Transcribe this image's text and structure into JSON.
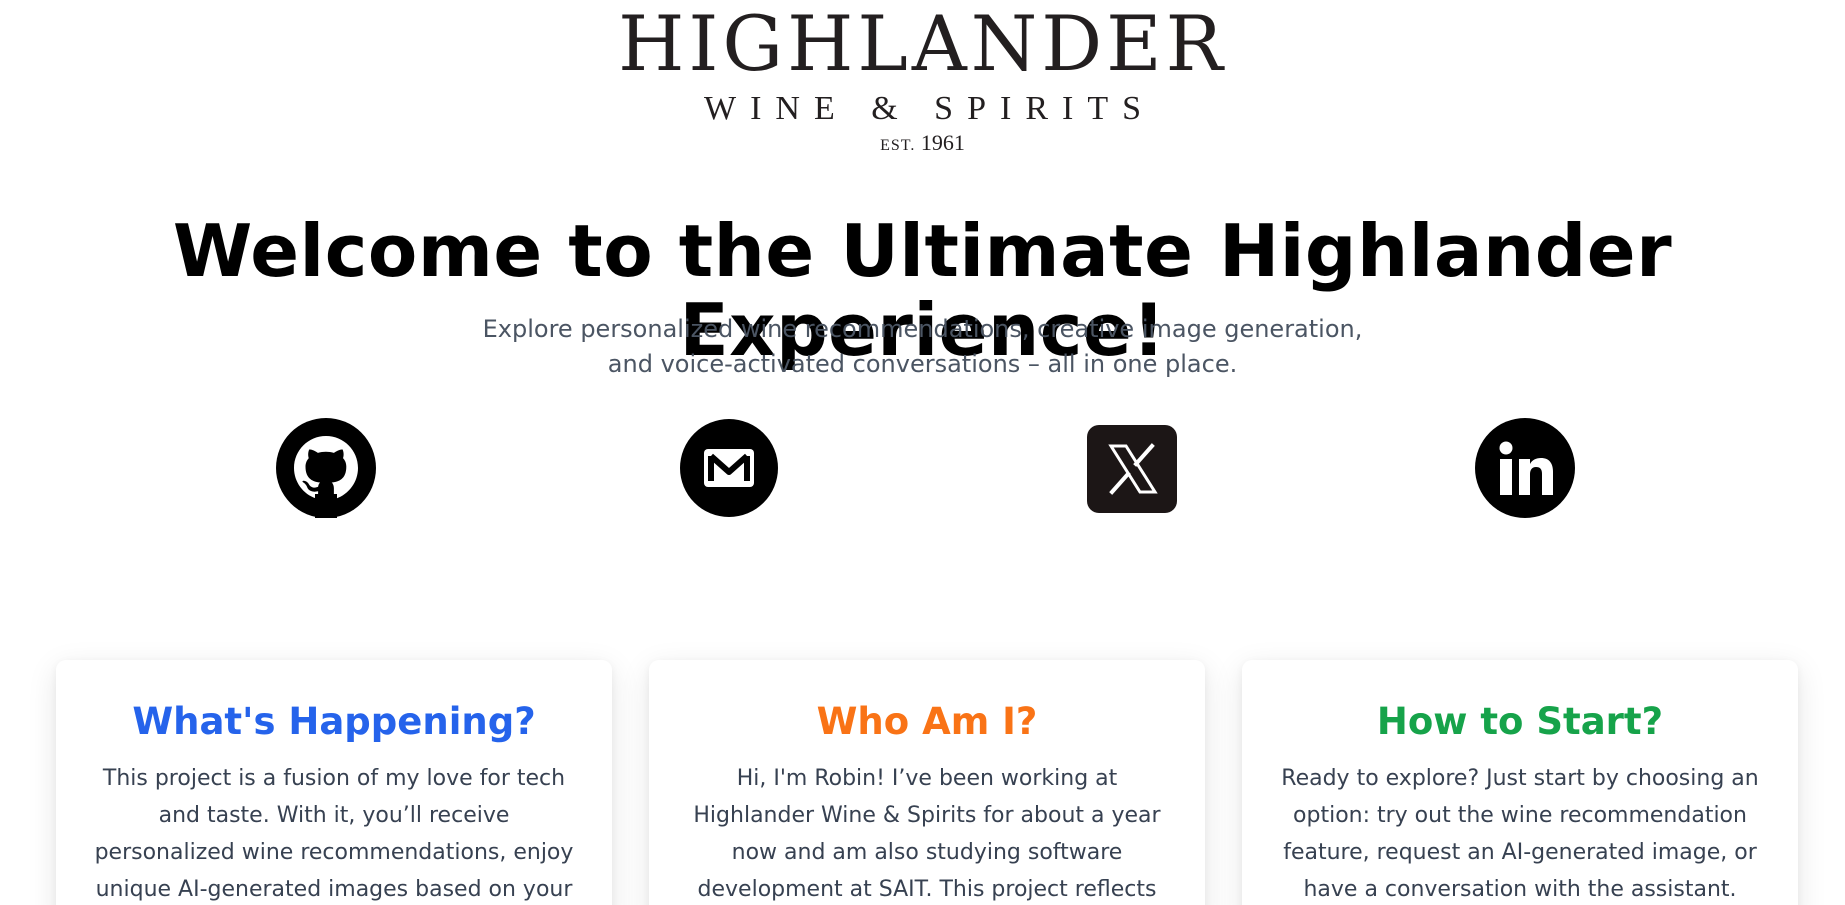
{
  "logo": {
    "name": "HIGHLANDER",
    "tagline": "WINE & SPIRITS",
    "est_label": "EST.",
    "est_year": "1961"
  },
  "hero": {
    "title": "Welcome to the Ultimate Highlander Experience!",
    "subtitle_line1": "Explore personalized wine recommendations, creative image generation,",
    "subtitle_line2": "and voice-activated conversations – all in one place."
  },
  "social": [
    {
      "icon": "github-icon"
    },
    {
      "icon": "gmail-icon"
    },
    {
      "icon": "x-icon"
    },
    {
      "icon": "linkedin-icon"
    }
  ],
  "cards": [
    {
      "title": "What's Happening?",
      "color": "#2563eb",
      "body": "This project is a fusion of my love for tech and taste. With it, you’ll receive personalized wine recommendations, enjoy unique AI-generated images based on your preferences, and even"
    },
    {
      "title": "Who Am I?",
      "color": "#f97316",
      "body": "Hi, I'm Robin! I’ve been working at Highlander Wine & Spirits for about a year now and am also studying software development at SAIT. This project reflects my journey in blending"
    },
    {
      "title": "How to Start?",
      "color": "#16a34a",
      "body": "Ready to explore? Just start by choosing an option: try out the wine recommendation feature, request an AI-generated image, or have a conversation with the assistant. Dive in"
    }
  ]
}
